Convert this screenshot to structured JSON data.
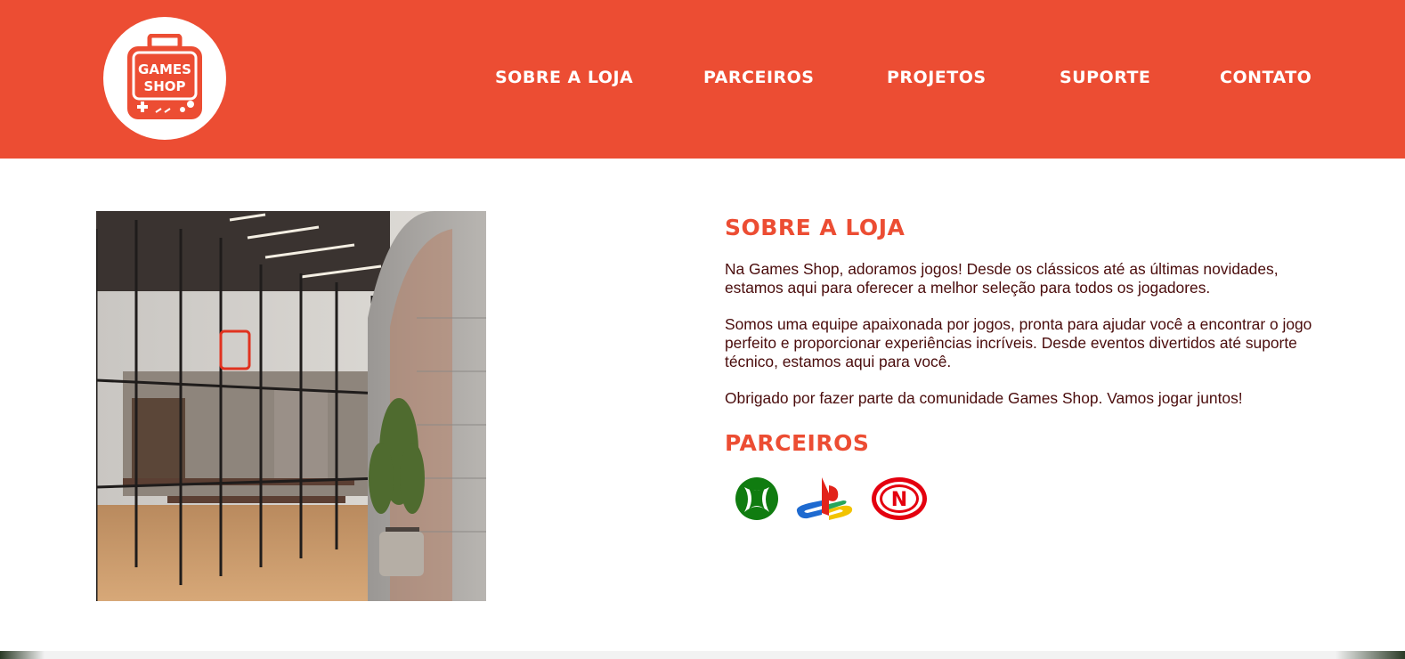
{
  "brand": {
    "logo_text_line1": "GAMES",
    "logo_text_line2": "SHOP",
    "accent_color": "#ec4d33",
    "text_color": "#4a0c0c"
  },
  "nav": {
    "items": [
      {
        "label": "SOBRE A LOJA"
      },
      {
        "label": "PARCEIROS"
      },
      {
        "label": "PROJETOS"
      },
      {
        "label": "SUPORTE"
      },
      {
        "label": "CONTATO"
      }
    ]
  },
  "hero": {
    "image_icon": "store-interior-photo"
  },
  "about": {
    "title": "SOBRE A LOJA",
    "paragraphs": [
      "Na Games Shop, adoramos jogos! Desde os clássicos até as últimas novidades, estamos aqui para oferecer a melhor seleção para todos os jogadores.",
      "Somos uma equipe apaixonada por jogos, pronta para ajudar você a encontrar o jogo perfeito e proporcionar experiências incríveis. Desde eventos divertidos até suporte técnico, estamos aqui para você.",
      "Obrigado por fazer parte da comunidade Games Shop. Vamos jogar juntos!"
    ]
  },
  "partners": {
    "title": "PARCEIROS",
    "logos": [
      {
        "icon": "xbox-logo-icon"
      },
      {
        "icon": "playstation-logo-icon"
      },
      {
        "icon": "nintendo-logo-icon"
      }
    ]
  }
}
